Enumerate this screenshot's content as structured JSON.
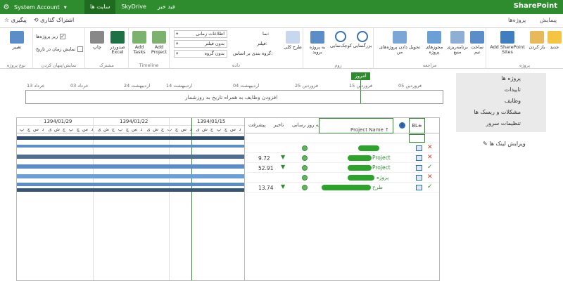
{
  "suite": {
    "brand": "SharePoint",
    "links": [
      "فید خبر",
      "SkyDrive",
      "سایت ها"
    ],
    "account": "System Account"
  },
  "tabs": {
    "browse": "پیمایش",
    "projects": "پروژه‌ها",
    "share": "اشتراک گذاری",
    "follow": "پیگیری"
  },
  "ribbon": {
    "groups": {
      "project": "پروژه",
      "navigate": "مراجعه",
      "zoom": "زوم",
      "data": "داده",
      "timeline": "Timeline",
      "share": "مشترک",
      "showhide": "نمایش/پنهان کردن",
      "view": "نوع پروژه"
    },
    "buttons": {
      "new": "جدید",
      "open": "باز کردن",
      "add_sites": "Add SharePoint Sites",
      "build_team": "ساخت تیم",
      "resource_plan": "برنامه‌ریزی منبع",
      "project_perms": "مجوزهای پروژه",
      "check_in": "تحویل دادن پروژه‌های من",
      "zoom_in": "بزرگنمایی",
      "zoom_out": "کوچک‌نمایی",
      "scroll_to": "به پروژه بروید",
      "outline": "طرح کلی",
      "add_project": "Add Project",
      "add_tasks": "Add Tasks",
      "export_excel": "صدوردر Excel",
      "print": "چاپ",
      "change": "تغییر"
    },
    "selects": [
      "اطلاعات زمانی",
      "بدون فیلتر",
      "بدون گروه"
    ],
    "labels": {
      "view": "نما:",
      "filter": "فیلتر:",
      "group": "گروه بندی بر اساس:"
    },
    "checks": {
      "subprojects": "زیر پروژه‌ها",
      "time_with_date": "نمایش زمان در تاریخ"
    }
  },
  "timeline": {
    "today": "امروز",
    "dates": [
      "فروردین 05",
      "فروردین 15",
      "فروردین 25",
      "اردیبهشت 04",
      "اردیبهشت 14",
      "اردیبهشت 24",
      "خرداد 03",
      "خرداد 13"
    ],
    "placeholder": "افزودن وظایف به همراه تاریخ به روزشمار"
  },
  "quicklaunch": [
    "پروژه ها",
    "تاییدات",
    "وظایف",
    "مشکلات و ریسک ها",
    "تنظیمات سرور"
  ],
  "edit_links": "ویرایش لینک ها",
  "gantt": {
    "weeks": [
      "1394/01/29",
      "1394/01/22",
      "1394/01/15"
    ],
    "days": [
      "پ",
      "چ",
      "س",
      "د",
      "ی",
      "ش",
      "ج",
      "پ",
      "چ",
      "س",
      "د",
      "ی",
      "ش",
      "ج",
      "پ",
      "چ",
      "س",
      "د",
      "ی",
      "ش",
      "ج",
      "پ",
      "چ",
      "س",
      "د",
      "ی",
      "ش",
      "ج",
      "پ",
      "چ",
      "س",
      "د"
    ]
  },
  "grid": {
    "headers": {
      "progress": "پیشرفت",
      "delay": "تاخیر",
      "updated": "به روز رسانی",
      "name": "Project Name ↑",
      "bl": "BL±"
    },
    "rows": [
      {
        "progress": "",
        "name": "",
        "status": "",
        "dot": false
      },
      {
        "progress": "",
        "name": "",
        "status": "✕",
        "dot": true
      },
      {
        "progress": "9.72",
        "name": "Project",
        "status": "✕",
        "dot": true
      },
      {
        "progress": "52.91",
        "name": "Project",
        "status": "✓",
        "dot": true
      },
      {
        "progress": "",
        "name": "پروژه",
        "status": "✕",
        "dot": true
      },
      {
        "progress": "13.74",
        "name": "طرح",
        "status": "✓",
        "dot": true
      }
    ]
  }
}
